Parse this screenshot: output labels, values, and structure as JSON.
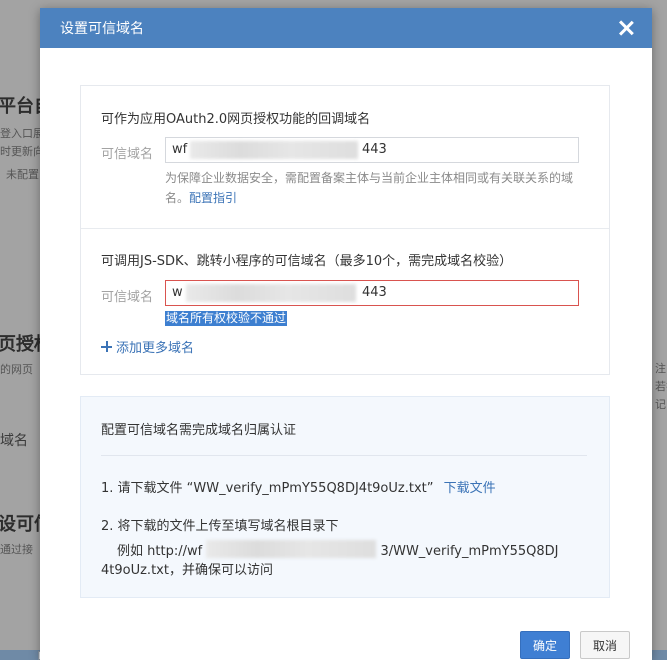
{
  "background": {
    "texts": [
      "平台自建",
      "登入口展",
      "时更新向",
      "未配置",
      "页授权后",
      "的网页",
      "域名",
      "设可信域",
      "通过接"
    ],
    "right_texts": [
      "注",
      "若打",
      "记"
    ]
  },
  "dialog": {
    "title": "设置可信域名",
    "oauth_section": {
      "title": "可作为应用OAuth2.0网页授权功能的回调域名",
      "label": "可信域名",
      "value_prefix": "wf",
      "value_suffix": "443",
      "hint": "为保障企业数据安全，需配置备案主体与当前企业主体相同或有关联关系的域名。",
      "hint_link": "配置指引"
    },
    "jssdk_section": {
      "title": "可调用JS-SDK、跳转小程序的可信域名（最多10个，需完成域名校验）",
      "label": "可信域名",
      "value_prefix": "w",
      "value_suffix": "443",
      "error": "域名所有权校验不通过",
      "add_more": "添加更多域名"
    },
    "verify": {
      "title": "配置可信域名需完成域名归属认证",
      "step1_prefix": "1. 请下载文件 “WW_verify_mPmY55Q8DJ4t9oUz.txt”",
      "step1_link": "下载文件",
      "step2_line1": "2. 将下载的文件上传至填写域名根目录下",
      "step2_example_prefix": "例如 http://wf",
      "step2_example_suffix": "3/WW_verify_mPmY55Q8DJ",
      "step2_line3": "4t9oUz.txt，并确保可以访问"
    },
    "buttons": {
      "ok": "确定",
      "cancel": "取消"
    }
  }
}
